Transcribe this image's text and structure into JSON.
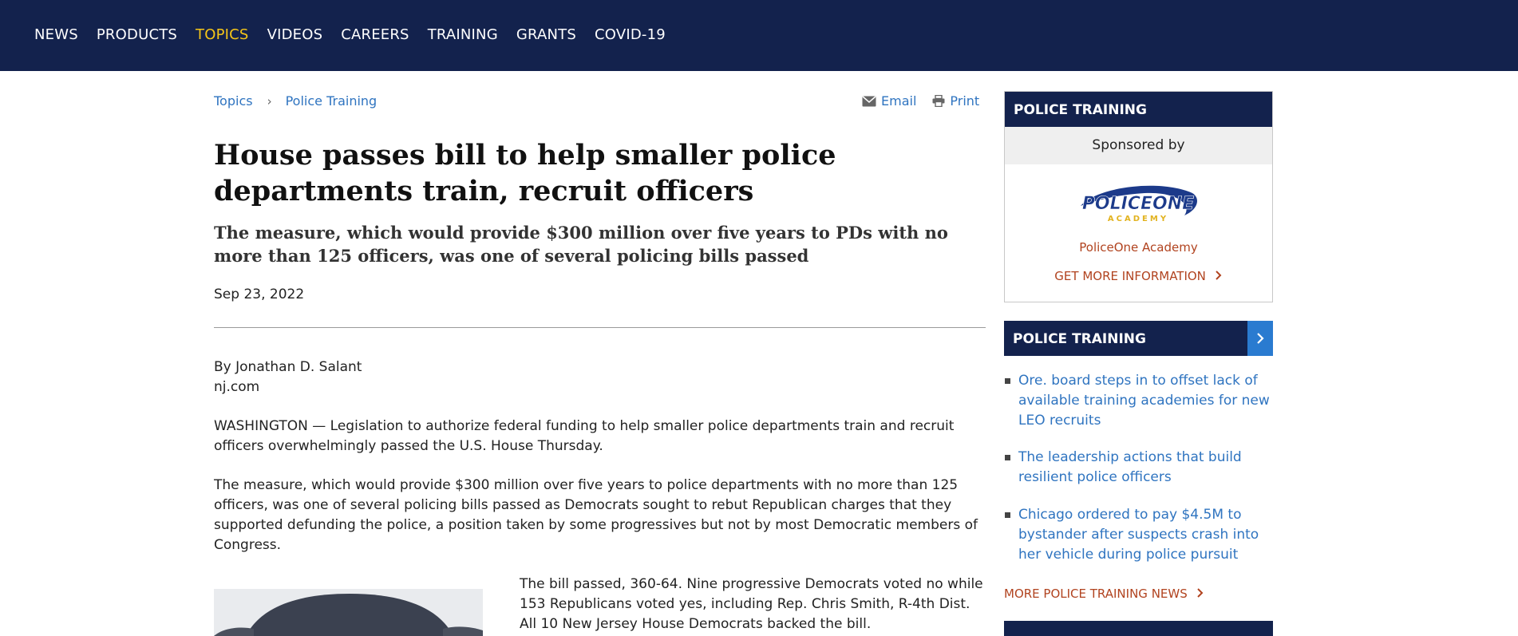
{
  "nav": {
    "items": [
      {
        "label": "NEWS"
      },
      {
        "label": "PRODUCTS"
      },
      {
        "label": "TOPICS"
      },
      {
        "label": "VIDEOS"
      },
      {
        "label": "CAREERS"
      },
      {
        "label": "TRAINING"
      },
      {
        "label": "GRANTS"
      },
      {
        "label": "COVID-19"
      }
    ],
    "active_color": "#f5c518",
    "bg_color": "#13224d"
  },
  "breadcrumb": {
    "items": [
      "Topics",
      "Police Training"
    ],
    "separator": "›"
  },
  "tools": {
    "email_label": "Email",
    "print_label": "Print"
  },
  "article": {
    "headline": "House passes bill to help smaller police departments train, recruit officers",
    "dek": "The measure, which would provide $300 million over five years to PDs with no more than 125 officers, was one of several policing bills passed",
    "date": "Sep 23, 2022",
    "byline": "By Jonathan D. Salant",
    "source": "nj.com",
    "paragraphs": [
      "WASHINGTON — Legislation to authorize federal funding to help smaller police departments train and recruit officers overwhelmingly passed the U.S. House Thursday.",
      "The measure, which would provide $300 million over five years to police departments with no more than 125 officers, was one of several policing bills passed as Democrats sought to rebut Republican charges that they supported defunding the police, a position taken by some progressives but not by most Democratic members of Congress.",
      "The bill passed, 360-64. Nine progressive Democrats voted no while 153 Republicans voted yes, including Rep. Chris Smith, R-4th Dist. All 10 New Jersey House Democrats backed the bill."
    ]
  },
  "sidebar": {
    "sponsor_box": {
      "title": "POLICE TRAINING",
      "sponsored_by": "Sponsored by",
      "logo_text_main": "POLICEONE",
      "logo_text_sub": "ACADEMY",
      "sponsor_name": "PoliceOne Academy",
      "cta": "GET MORE INFORMATION"
    },
    "news_box": {
      "title": "POLICE TRAINING",
      "items": [
        "Ore. board steps in to offset lack of available training academies for new LEO recruits",
        "The leadership actions that build resilient police officers",
        "Chicago ordered to pay $4.5M to bystander after suspects crash into her vehicle during police pursuit"
      ],
      "more": "MORE POLICE TRAINING NEWS"
    },
    "accent_color": "#b1431f",
    "link_color": "#2f74c0"
  }
}
